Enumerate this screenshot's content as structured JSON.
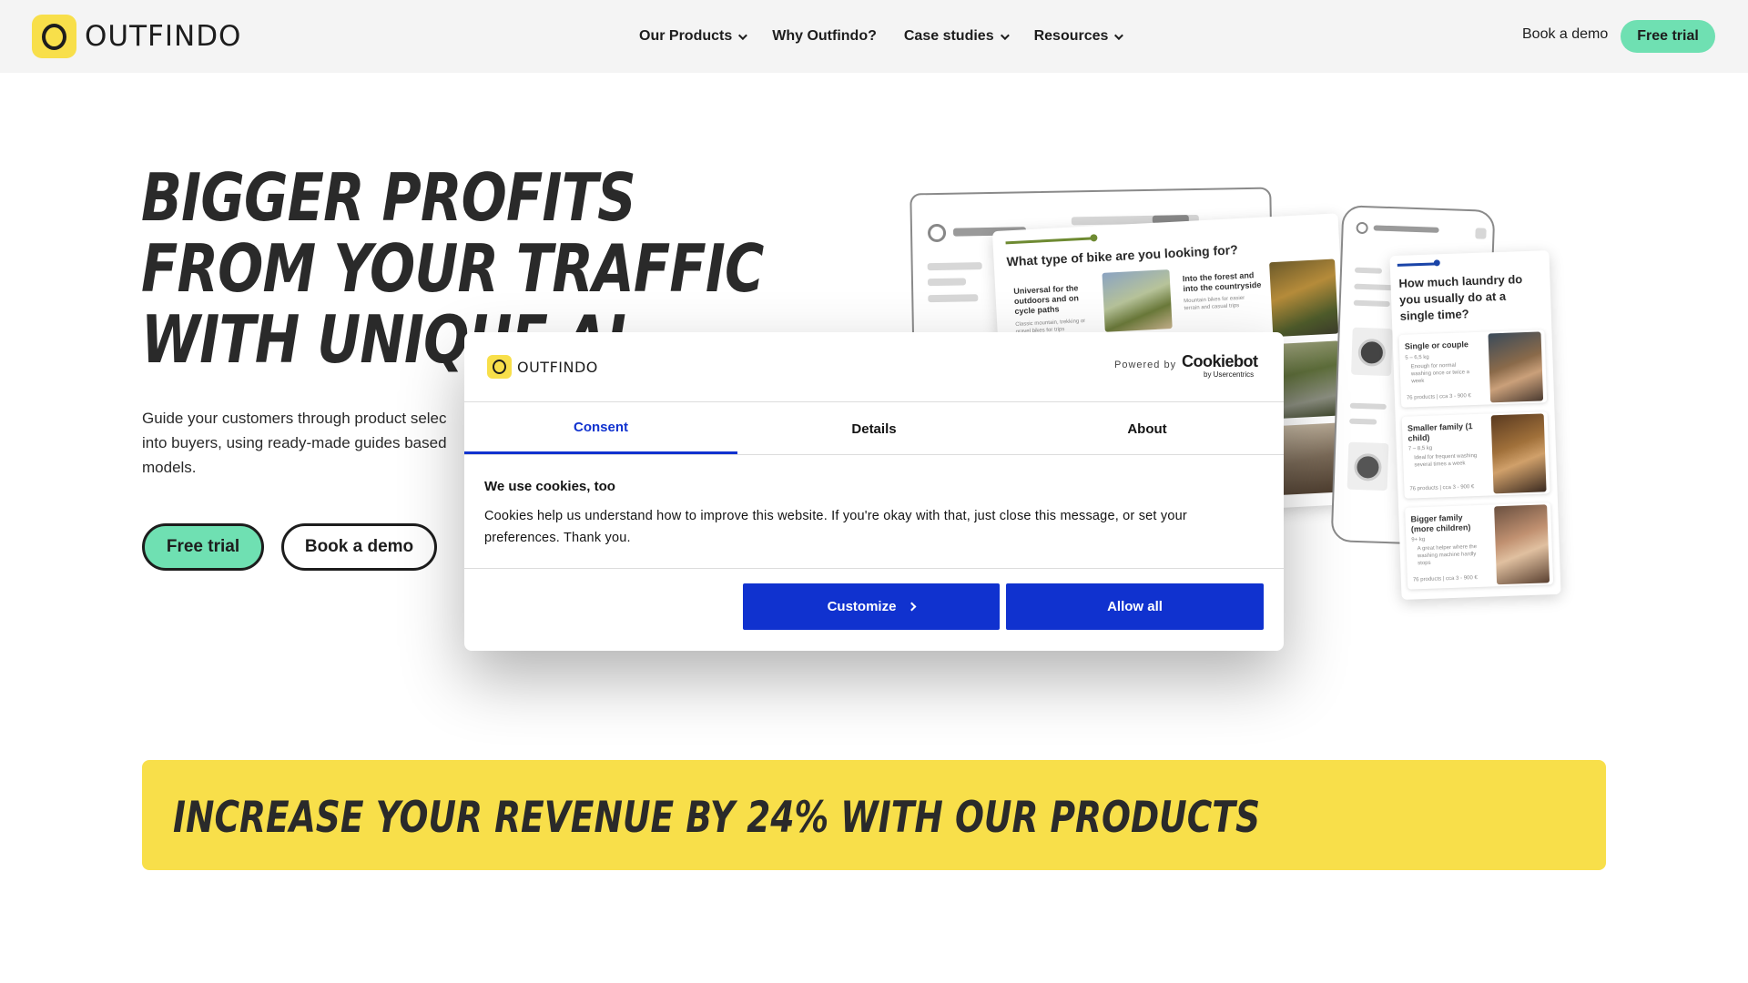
{
  "nav": {
    "logo_text": "OUTFINDO",
    "menu": [
      {
        "label": "Our Products",
        "has_dropdown": true
      },
      {
        "label": "Why Outfindo?",
        "has_dropdown": false
      },
      {
        "label": "Case studies",
        "has_dropdown": true
      },
      {
        "label": "Resources",
        "has_dropdown": true
      }
    ],
    "book_demo": "Book a demo",
    "free_trial": "Free trial"
  },
  "hero": {
    "title_lines": [
      "BIGGER PROFITS",
      "FROM YOUR TRAFFIC",
      "WITH UNIQUE AI"
    ],
    "subtitle_lines": [
      "Guide your customers through product selec",
      "into buyers, using ready-made guides based",
      "models."
    ],
    "cta_trial": "Free trial",
    "cta_demo": "Book a demo"
  },
  "mockups": {
    "bike_question": "What type of bike are you looking for?",
    "bike_options": [
      {
        "title": "Universal for the outdoors and on cycle paths",
        "desc": "Classic mountain, trekking or gravel bikes for trips"
      },
      {
        "title": "Into the forest and into the countryside",
        "desc": "Mountain bikes for easier terrain and casual trips"
      }
    ],
    "laundry_question": "How much laundry do you usually do at a single time?",
    "laundry_options": [
      {
        "title": "Single or couple",
        "meta": "5 – 6,5 kg",
        "desc": "Enough for normal washing once or twice a week",
        "footer": "76 products | cca 3 - 900 €"
      },
      {
        "title": "Smaller family (1 child)",
        "meta": "7 – 8,5 kg",
        "desc": "Ideal for frequent washing several times a week",
        "footer": "76 products | cca 3 - 900 €"
      },
      {
        "title": "Bigger family (more children)",
        "meta": "9+ kg",
        "desc": "A great helper where the washing machine hardly stops",
        "footer": "76 products | cca 3 - 900 €"
      }
    ]
  },
  "banner": {
    "text": "INCREASE YOUR REVENUE BY 24% WITH OUR PRODUCTS"
  },
  "cookie_dialog": {
    "logo_text": "OUTFINDO",
    "powered_by": "Powered by",
    "brand": "Cookiebot",
    "brand_sub": "by Usercentrics",
    "tabs": [
      {
        "label": "Consent",
        "active": true
      },
      {
        "label": "Details",
        "active": false
      },
      {
        "label": "About",
        "active": false
      }
    ],
    "title": "We use cookies, too",
    "body": "Cookies help us understand how to improve this website. If you're okay with that, just close this message, or set your preferences. Thank you.",
    "customize_label": "Customize",
    "allow_all_label": "Allow all"
  },
  "colors": {
    "brand_yellow": "#f8df4a",
    "mint": "#6fe0b2",
    "cookie_blue": "#1032cf"
  }
}
